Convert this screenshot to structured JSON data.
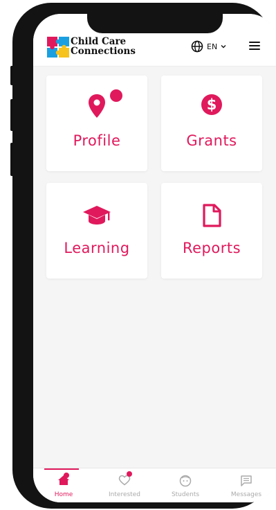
{
  "colors": {
    "accent": "#e0195c",
    "muted": "#aaaaaa",
    "background": "#f5f5f5"
  },
  "header": {
    "brand_line1": "Child Care",
    "brand_line2": "Connections",
    "language": "EN",
    "icons": {
      "language": "globe-icon",
      "dropdown": "chevron-down-icon",
      "menu": "hamburger-menu-icon"
    }
  },
  "cards": [
    {
      "label": "Profile",
      "icon": "map-pin-icon",
      "has_notification": true
    },
    {
      "label": "Grants",
      "icon": "dollar-circle-icon",
      "has_notification": false
    },
    {
      "label": "Learning",
      "icon": "graduation-cap-icon",
      "has_notification": false
    },
    {
      "label": "Reports",
      "icon": "document-icon",
      "has_notification": false
    }
  ],
  "tabs": [
    {
      "label": "Home",
      "icon": "home-icon",
      "active": true,
      "has_notification": true
    },
    {
      "label": "Interested",
      "icon": "heart-icon",
      "active": false,
      "has_notification": true
    },
    {
      "label": "Students",
      "icon": "child-face-icon",
      "active": false,
      "has_notification": false
    },
    {
      "label": "Messages",
      "icon": "message-icon",
      "active": false,
      "has_notification": false
    }
  ]
}
